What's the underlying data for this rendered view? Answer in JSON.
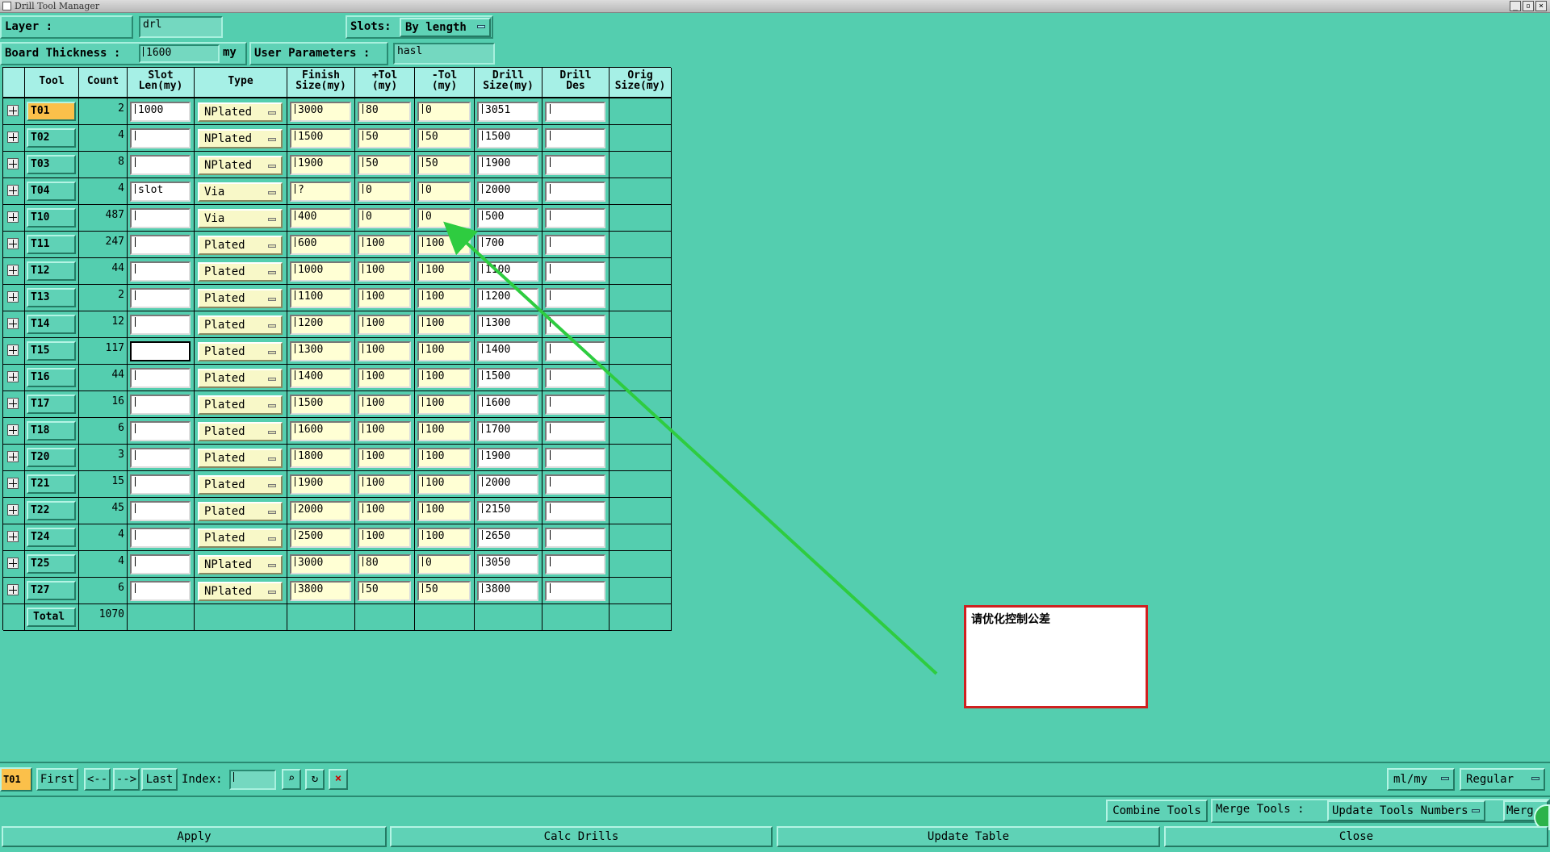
{
  "window": {
    "title": "Drill Tool Manager"
  },
  "top": {
    "layer_label": "Layer          :",
    "layer_value": "drl",
    "slots_label": "Slots:",
    "slots_value": "By length",
    "board_label": "Board Thickness :",
    "board_value": "1600",
    "board_unit": "my",
    "user_label": "User Parameters :",
    "user_value": "hasl"
  },
  "table": {
    "headers": [
      "Tool",
      "Count",
      "Slot\nLen(my)",
      "Type",
      "Finish\nSize(my)",
      "+Tol\n(my)",
      "-Tol\n(my)",
      "Drill\nSize(my)",
      "Drill\nDes",
      "Orig\nSize(my)"
    ],
    "rows": [
      {
        "tool": "T01",
        "count": "2",
        "slot": "1000",
        "type": "NPlated",
        "finish": "3000",
        "ptol": "80",
        "mtol": "0",
        "drill": "3051"
      },
      {
        "tool": "T02",
        "count": "4",
        "slot": "",
        "type": "NPlated",
        "finish": "1500",
        "ptol": "50",
        "mtol": "50",
        "drill": "1500"
      },
      {
        "tool": "T03",
        "count": "8",
        "slot": "",
        "type": "NPlated",
        "finish": "1900",
        "ptol": "50",
        "mtol": "50",
        "drill": "1900"
      },
      {
        "tool": "T04",
        "count": "4",
        "slot": "slot",
        "type": "Via",
        "finish": "?",
        "ptol": "0",
        "mtol": "0",
        "drill": "2000"
      },
      {
        "tool": "T10",
        "count": "487",
        "slot": "",
        "type": "Via",
        "finish": "400",
        "ptol": "0",
        "mtol": "0",
        "drill": "500"
      },
      {
        "tool": "T11",
        "count": "247",
        "slot": "",
        "type": "Plated",
        "finish": "600",
        "ptol": "100",
        "mtol": "100",
        "drill": "700"
      },
      {
        "tool": "T12",
        "count": "44",
        "slot": "",
        "type": "Plated",
        "finish": "1000",
        "ptol": "100",
        "mtol": "100",
        "drill": "1100"
      },
      {
        "tool": "T13",
        "count": "2",
        "slot": "",
        "type": "Plated",
        "finish": "1100",
        "ptol": "100",
        "mtol": "100",
        "drill": "1200"
      },
      {
        "tool": "T14",
        "count": "12",
        "slot": "",
        "type": "Plated",
        "finish": "1200",
        "ptol": "100",
        "mtol": "100",
        "drill": "1300"
      },
      {
        "tool": "T15",
        "count": "117",
        "slot": "",
        "type": "Plated",
        "finish": "1300",
        "ptol": "100",
        "mtol": "100",
        "drill": "1400"
      },
      {
        "tool": "T16",
        "count": "44",
        "slot": "",
        "type": "Plated",
        "finish": "1400",
        "ptol": "100",
        "mtol": "100",
        "drill": "1500"
      },
      {
        "tool": "T17",
        "count": "16",
        "slot": "",
        "type": "Plated",
        "finish": "1500",
        "ptol": "100",
        "mtol": "100",
        "drill": "1600"
      },
      {
        "tool": "T18",
        "count": "6",
        "slot": "",
        "type": "Plated",
        "finish": "1600",
        "ptol": "100",
        "mtol": "100",
        "drill": "1700"
      },
      {
        "tool": "T20",
        "count": "3",
        "slot": "",
        "type": "Plated",
        "finish": "1800",
        "ptol": "100",
        "mtol": "100",
        "drill": "1900"
      },
      {
        "tool": "T21",
        "count": "15",
        "slot": "",
        "type": "Plated",
        "finish": "1900",
        "ptol": "100",
        "mtol": "100",
        "drill": "2000"
      },
      {
        "tool": "T22",
        "count": "45",
        "slot": "",
        "type": "Plated",
        "finish": "2000",
        "ptol": "100",
        "mtol": "100",
        "drill": "2150"
      },
      {
        "tool": "T24",
        "count": "4",
        "slot": "",
        "type": "Plated",
        "finish": "2500",
        "ptol": "100",
        "mtol": "100",
        "drill": "2650"
      },
      {
        "tool": "T25",
        "count": "4",
        "slot": "",
        "type": "NPlated",
        "finish": "3000",
        "ptol": "80",
        "mtol": "0",
        "drill": "3050"
      },
      {
        "tool": "T27",
        "count": "6",
        "slot": "",
        "type": "NPlated",
        "finish": "3800",
        "ptol": "50",
        "mtol": "50",
        "drill": "3800"
      }
    ],
    "total_label": "Total",
    "total_count": "1070"
  },
  "annotation": {
    "text": "请优化控制公差"
  },
  "nav": {
    "current_tool": "T01",
    "first": "First",
    "prev": "<--",
    "next": "-->",
    "last": "Last",
    "index_label": "Index:",
    "index_value": "",
    "units": "ml/my",
    "mode": "Regular"
  },
  "merge": {
    "combine": "Combine Tools",
    "merge_label": "Merge Tools :",
    "merge_value": "Update Tools Numbers",
    "merge_btn": "Merg"
  },
  "bottom": {
    "apply": "Apply",
    "calc": "Calc Drills",
    "update": "Update Table",
    "close": "Close"
  }
}
